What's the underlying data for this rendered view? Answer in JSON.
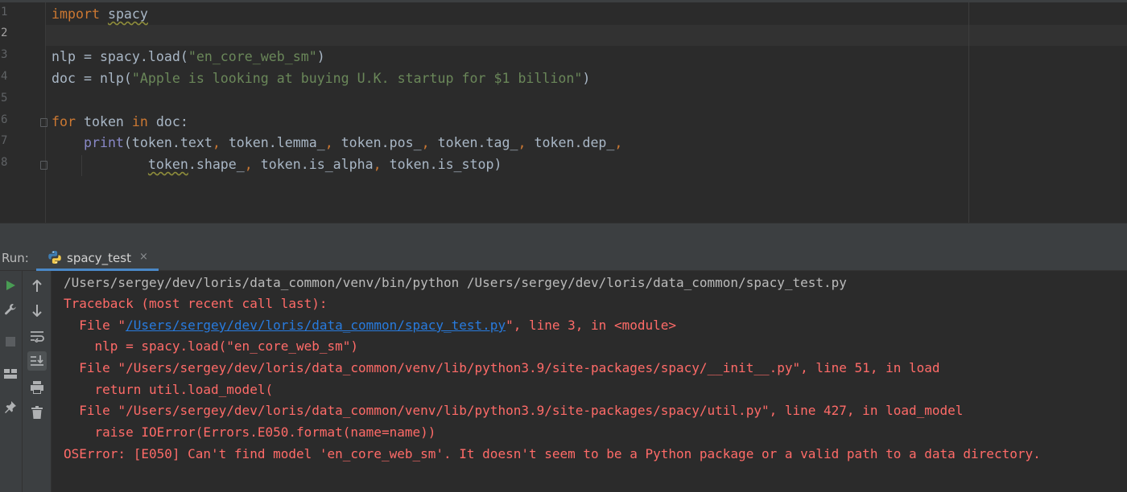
{
  "editor": {
    "line_numbers": [
      "1",
      "2",
      "3",
      "4",
      "5",
      "6",
      "7",
      "8"
    ],
    "active_line": "2",
    "code": {
      "l1_kw": "import",
      "l1_mod": "spacy",
      "l3_a": "nlp = spacy.load(",
      "l3_str": "\"en_core_web_sm\"",
      "l3_b": ")",
      "l4_a": "doc = nlp(",
      "l4_str": "\"Apple is looking at buying U.K. startup for $1 billion\"",
      "l4_b": ")",
      "l6_kw1": "for",
      "l6_a": " token ",
      "l6_kw2": "in",
      "l6_b": " doc:",
      "l7_indent": "    ",
      "l7_fn": "print",
      "l7_a": "(token.text",
      "l7_c1": ",",
      "l7_b": " token.lemma_",
      "l7_c2": ",",
      "l7_c": " token.pos_",
      "l7_c3": ",",
      "l7_d": " token.tag_",
      "l7_c4": ",",
      "l7_e": " token.dep_",
      "l7_c5": ",",
      "l8_indent": "            ",
      "l8_sq": "token",
      "l8_a": ".shape_",
      "l8_c1": ",",
      "l8_b": " token.is_alpha",
      "l8_c2": ",",
      "l8_c": " token.is_stop)"
    }
  },
  "run_panel": {
    "label": "Run:",
    "tab_label": "spacy_test",
    "tab_close": "×"
  },
  "console": {
    "command": "/Users/sergey/dev/loris/data_common/venv/bin/python /Users/sergey/dev/loris/data_common/spacy_test.py",
    "traceback_header": "Traceback (most recent call last):",
    "frame1_prefix": "  File \"",
    "frame1_link": "/Users/sergey/dev/loris/data_common/spacy_test.py",
    "frame1_suffix": "\", line 3, in <module>",
    "frame1_code": "    nlp = spacy.load(\"en_core_web_sm\")",
    "frame2": "  File \"/Users/sergey/dev/loris/data_common/venv/lib/python3.9/site-packages/spacy/__init__.py\", line 51, in load",
    "frame2_code": "    return util.load_model(",
    "frame3": "  File \"/Users/sergey/dev/loris/data_common/venv/lib/python3.9/site-packages/spacy/util.py\", line 427, in load_model",
    "frame3_code": "    raise IOError(Errors.E050.format(name=name))",
    "error": "OSError: [E050] Can't find model 'en_core_web_sm'. It doesn't seem to be a Python package or a valid path to a data directory."
  },
  "colors": {
    "background": "#2b2b2b",
    "keyword": "#cc7832",
    "string": "#6a8759",
    "error": "#ff6b68",
    "link": "#287bde",
    "run_green": "#499c54"
  }
}
